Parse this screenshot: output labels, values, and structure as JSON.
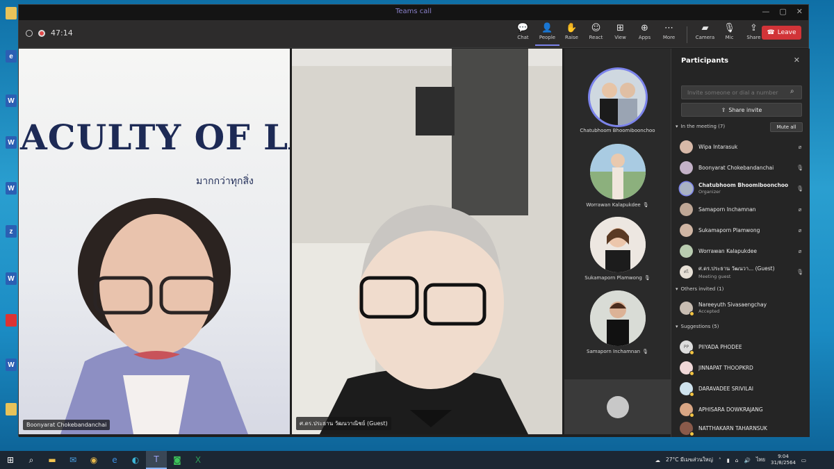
{
  "window": {
    "title": "Teams call"
  },
  "meeting": {
    "timer": "47:14"
  },
  "toolbar": {
    "chat": "Chat",
    "people": "People",
    "raise": "Raise",
    "react": "React",
    "view": "View",
    "apps": "Apps",
    "more": "More",
    "camera": "Camera",
    "mic": "Mic",
    "share": "Share",
    "leave": "Leave"
  },
  "videos": [
    {
      "name": "Boonyarat Chokebandanchai",
      "banner": "ACULTY OF LA",
      "banner_sub": "มากกว่าทุกสิ่ง"
    },
    {
      "name": "ศ.ดร.ประธาน วัฒนวาณิชย์ (Guest)"
    }
  ],
  "gallery": [
    {
      "name": "Chatubhoom Bhoomiboonchoo"
    },
    {
      "name": "Worrawan Kalapukdee"
    },
    {
      "name": "Sukamaporn Plamwong"
    },
    {
      "name": "Samaporn Inchamnan"
    }
  ],
  "participants_panel": {
    "title": "Participants",
    "search_placeholder": "Invite someone or dial a number",
    "share_invite": "Share invite",
    "in_meeting": "In the meeting (7)",
    "mute_all": "Mute all",
    "others_invited": "Others invited (1)",
    "suggestions": "Suggestions (5)",
    "in_meeting_list": [
      {
        "name": "Wipa Intarasuk",
        "sub": "",
        "initials": ""
      },
      {
        "name": "Boonyarat Chokebandanchai",
        "sub": "",
        "initials": ""
      },
      {
        "name": "Chatubhoom Bhoomiboonchoo",
        "sub": "Organizer",
        "initials": ""
      },
      {
        "name": "Samaporn Inchamnan",
        "sub": "",
        "initials": ""
      },
      {
        "name": "Sukamaporn Plamwong",
        "sub": "",
        "initials": ""
      },
      {
        "name": "Worrawan Kalapukdee",
        "sub": "",
        "initials": ""
      },
      {
        "name": "ศ.ดร.ประธาน วัฒนวา... (Guest)",
        "sub": "Meeting guest",
        "initials": "ศไ"
      }
    ],
    "invited_list": [
      {
        "name": "Nareeyuth Sivasaengchay",
        "sub": "Accepted",
        "initials": ""
      }
    ],
    "suggestion_list": [
      {
        "name": "PIIYADA PHODEE",
        "initials": "PP"
      },
      {
        "name": "JINNAPAT THOOPKRD",
        "initials": ""
      },
      {
        "name": "DARAVADEE SRIVILAI",
        "initials": ""
      },
      {
        "name": "APHISARA DOWKRAJANG",
        "initials": ""
      },
      {
        "name": "NATTHAKARN TAHARNSUK",
        "initials": ""
      }
    ]
  },
  "taskbar": {
    "weather": "27°C มีเมฆส่วนใหญ่",
    "lang": "ไทย",
    "time": "9:04",
    "date": "31/8/2564"
  }
}
